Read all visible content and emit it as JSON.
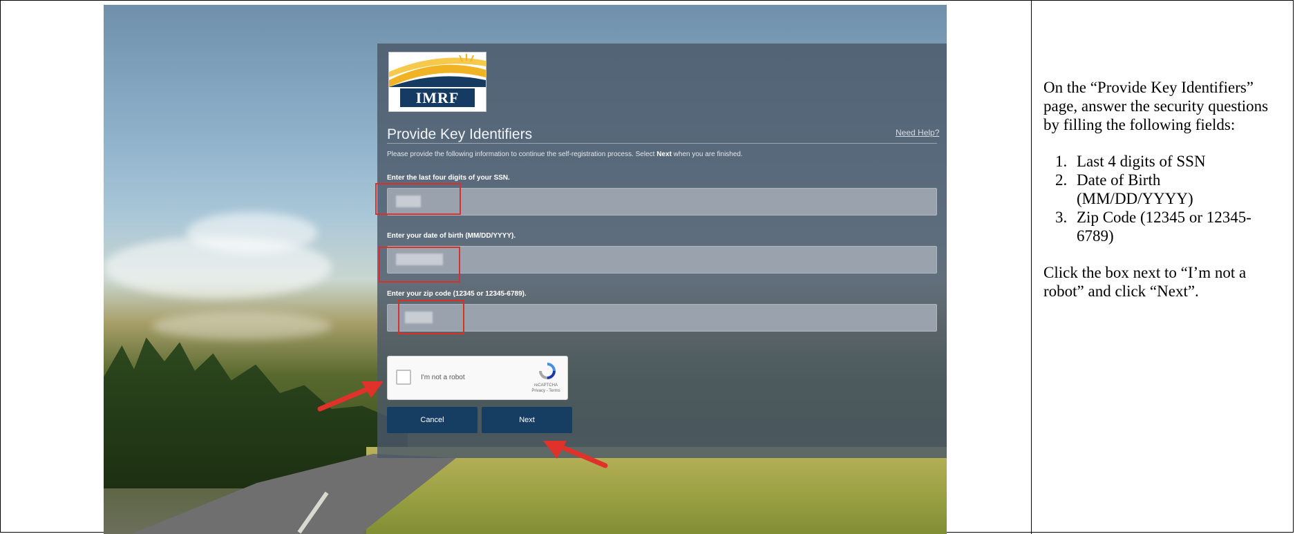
{
  "form": {
    "logo_text": "IMRF",
    "title": "Provide Key Identifiers",
    "help_link": "Need Help?",
    "intro_prefix": "Please provide the following information to continue the self-registration process. Select ",
    "intro_bold": "Next",
    "intro_suffix": " when you are finished.",
    "ssn_label": "Enter the last four digits of your SSN.",
    "dob_label": "Enter your date of birth (MM/DD/YYYY).",
    "zip_label": "Enter your zip code (12345 or 12345-6789).",
    "captcha_label": "I'm not a robot",
    "captcha_brand": "reCAPTCHA",
    "captcha_links": "Privacy - Terms",
    "cancel_label": "Cancel",
    "next_label": "Next"
  },
  "instructions": {
    "intro": "On the “Provide Key Identifiers” page, answer the security questions by filling the following fields:",
    "steps": [
      "Last 4 digits of SSN",
      "Date of Birth (MM/DD/YYYY)",
      "Zip Code (12345 or 12345-6789)"
    ],
    "outro": "Click the box next to “I’m not a robot” and click “Next”."
  },
  "colors": {
    "panel": "#4a5869",
    "button": "#163e63",
    "highlight": "#d9302a"
  }
}
